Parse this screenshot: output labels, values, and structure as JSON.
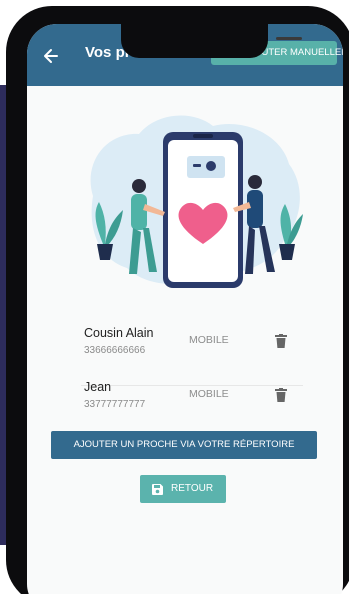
{
  "appbar": {
    "title": "Vos proches",
    "manual_button_label": "AJOUTER MANUELLEMENT",
    "back_icon": "arrow-left-icon"
  },
  "illustration": {
    "name": "phone-with-heart-illustration",
    "colors": {
      "blob": "#dcecf6",
      "heart": "#ef5f8c",
      "phone": "#2b3b6b",
      "plant": "#4fb3a7"
    }
  },
  "contacts": [
    {
      "name": "Cousin Alain",
      "phone": "33666666666",
      "type": "MOBILE",
      "icon": "trash-icon"
    },
    {
      "name": "Jean",
      "phone": "33777777777",
      "type": "MOBILE",
      "icon": "trash-icon"
    }
  ],
  "actions": {
    "add_from_directory_label": "AJOUTER UN PROCHE VIA VOTRE RÉPERTOIRE",
    "retour_label": "RETOUR",
    "retour_icon": "save-icon"
  },
  "colors": {
    "primary": "#336a8e",
    "accent": "#5bb3ad",
    "background": "#f9fafa"
  }
}
